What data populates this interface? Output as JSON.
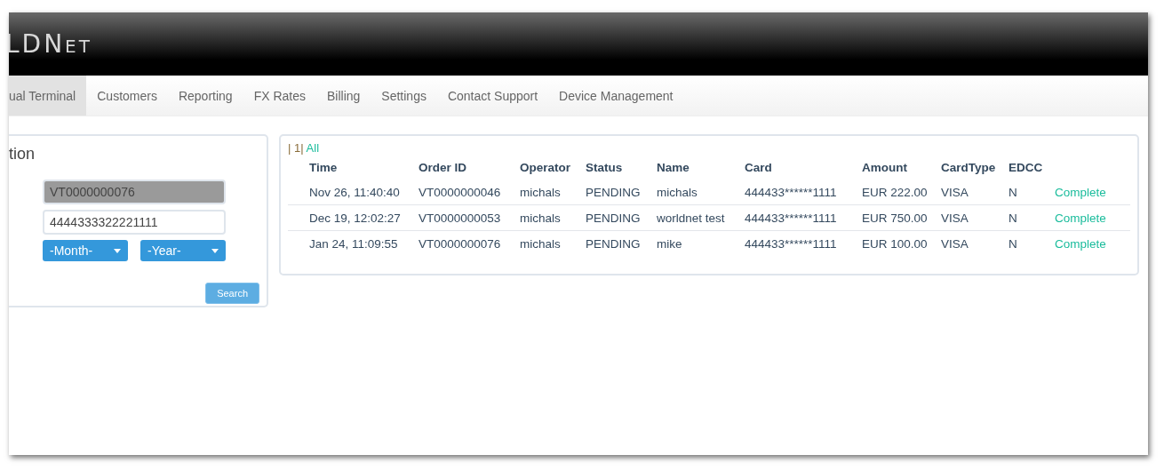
{
  "header": {
    "logo": "LDNet"
  },
  "nav": [
    {
      "label": "ual Terminal",
      "selected": true
    },
    {
      "label": "Customers",
      "selected": false
    },
    {
      "label": "Reporting",
      "selected": false
    },
    {
      "label": "FX Rates",
      "selected": false
    },
    {
      "label": "Billing",
      "selected": false
    },
    {
      "label": "Settings",
      "selected": false
    },
    {
      "label": "Contact Support",
      "selected": false
    },
    {
      "label": "Device Management",
      "selected": false
    }
  ],
  "search_panel": {
    "title": "tion",
    "order_id": {
      "value": "VT0000000076",
      "disabled": true
    },
    "card_number": {
      "value": "4444333322221111",
      "disabled": false
    },
    "month": "-Month-",
    "year": "-Year-",
    "button": "Search"
  },
  "results": {
    "pager": "| 1|",
    "pager_link": "All",
    "columns": [
      "Time",
      "Order ID",
      "Operator",
      "Status",
      "Name",
      "Card",
      "Amount",
      "CardType",
      "EDCC"
    ],
    "rows": [
      {
        "cells": [
          "Nov 26, 11:40:40",
          "VT0000000046",
          "michals",
          "PENDING",
          "michals",
          "444433******1111",
          "EUR 222.00",
          "VISA",
          "N"
        ],
        "action": "Complete"
      },
      {
        "cells": [
          "Dec 19, 12:02:27",
          "VT0000000053",
          "michals",
          "PENDING",
          "worldnet test",
          "444433******1111",
          "EUR 750.00",
          "VISA",
          "N"
        ],
        "action": "Complete"
      },
      {
        "cells": [
          "Jan 24, 11:09:55",
          "VT0000000076",
          "michals",
          "PENDING",
          "mike",
          "444433******1111",
          "EUR 100.00",
          "VISA",
          "N"
        ],
        "action": "Complete"
      }
    ]
  }
}
